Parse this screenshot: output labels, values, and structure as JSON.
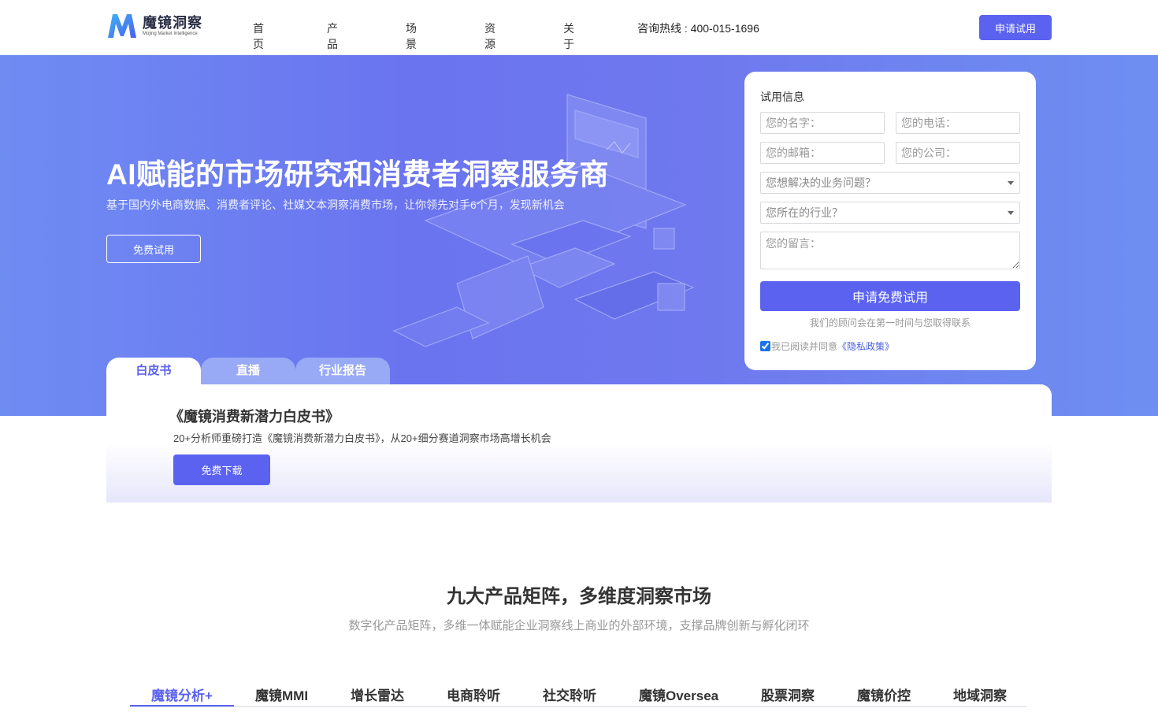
{
  "header": {
    "logo_cn": "魔镜洞察",
    "logo_en": "Mojing Market Intelligence",
    "nav": [
      "首页",
      "产品",
      "场景",
      "资源",
      "关于"
    ],
    "hotline": "咨询热线 : 400-015-1696",
    "apply_label": "申请试用"
  },
  "hero": {
    "title": "AI赋能的市场研究和消费者洞察服务商",
    "subtitle": "基于国内外电商数据、消费者评论、社媒文本洞察消费市场，让你领先对手6个月，发现新机会",
    "cta_label": "免费试用"
  },
  "tabs": [
    {
      "label": "白皮书",
      "active": true
    },
    {
      "label": "直播",
      "active": false
    },
    {
      "label": "行业报告",
      "active": false
    }
  ],
  "panel": {
    "title": "《魔镜消费新潜力白皮书》",
    "desc": "20+分析师重磅打造《魔镜消费新潜力白皮书》，从20+细分赛道洞察市场高增长机会",
    "btn_label": "免费下载"
  },
  "form": {
    "title": "试用信息",
    "name_ph": "您的名字：",
    "phone_ph": "您的电话：",
    "email_ph": "您的邮箱：",
    "company_ph": "您的公司：",
    "problem_ph": "您想解决的业务问题？",
    "industry_ph": "您所在的行业？",
    "message_ph": "您的留言：",
    "submit_label": "申请免费试用",
    "note": "我们的顾问会在第一时间与您取得联系",
    "agree_text": "我已阅读并同意",
    "policy_link": "《隐私政策》",
    "agree_checked": true
  },
  "section": {
    "title": "九大产品矩阵，多维度洞察市场",
    "subtitle": "数字化产品矩阵，多维一体赋能企业洞察线上商业的外部环境，支撑品牌创新与孵化闭环",
    "products": [
      "魔镜分析+",
      "魔镜MMI",
      "增长雷达",
      "电商聆听",
      "社交聆听",
      "魔镜Oversea",
      "股票洞察",
      "魔镜价控",
      "地域洞察"
    ],
    "active_index": 0
  },
  "colors": {
    "accent": "#5b62f0",
    "hero_gradient_start": "#6f8cf3",
    "hero_gradient_end": "#6e8ff2"
  }
}
